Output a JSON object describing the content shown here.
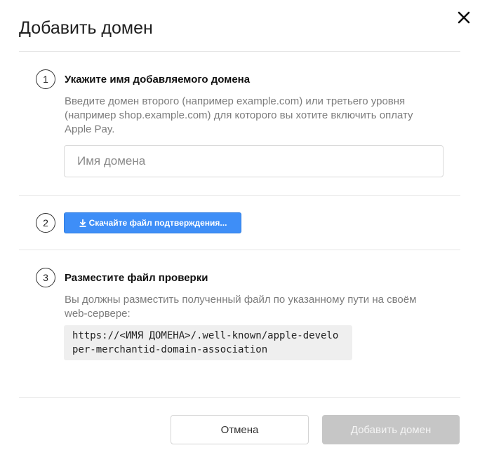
{
  "dialog": {
    "title": "Добавить домен",
    "close_icon": "close-icon"
  },
  "steps": [
    {
      "number": "1",
      "title": "Укажите имя добавляемого домена",
      "description": "Введите домен второго (например example.com) или третьего уровня (например shop.example.com) для которого вы хотите включить оплату Apple Pay.",
      "input": {
        "placeholder": "Имя домена",
        "value": ""
      }
    },
    {
      "number": "2",
      "button_label": "Скачайте файл подтверждения...",
      "button_icon": "download-icon",
      "button_color": "#3e8ef7"
    },
    {
      "number": "3",
      "title": "Разместите файл проверки",
      "description": "Вы должны разместить полученный файл по указанному пути на своём web-сервере:",
      "path": "https://<ИМЯ ДОМЕНА>/.well-known/apple-developer-merchantid-domain-association"
    }
  ],
  "footer": {
    "cancel_label": "Отмена",
    "submit_label": "Добавить домен",
    "submit_disabled": true
  }
}
